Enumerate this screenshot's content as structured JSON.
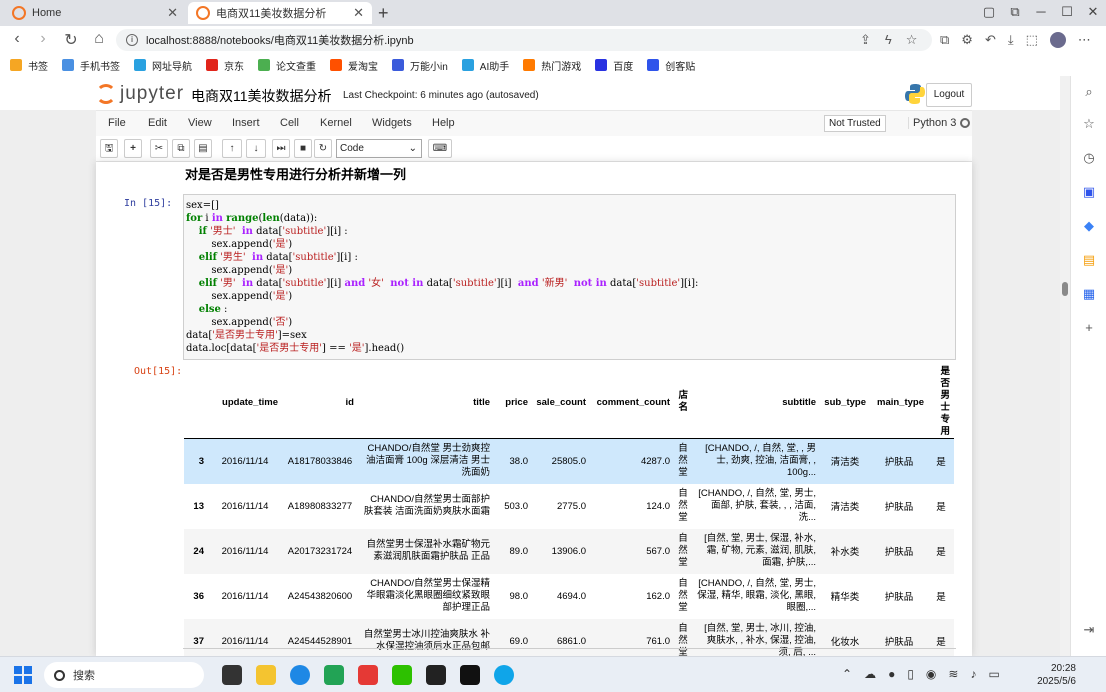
{
  "browser": {
    "tabs": [
      {
        "label": "Home"
      },
      {
        "label": "电商双11美妆数据分析"
      }
    ],
    "url": "localhost:8888/notebooks/电商双11美妆数据分析.ipynb",
    "bookmarks": [
      {
        "label": "书签",
        "color": "#f5a623"
      },
      {
        "label": "手机书签",
        "color": "#4a90e2"
      },
      {
        "label": "网址导航",
        "color": "#2aa1e0"
      },
      {
        "label": "京东",
        "color": "#e1251b"
      },
      {
        "label": "论文查重",
        "color": "#4caf50"
      },
      {
        "label": "爱淘宝",
        "color": "#ff5000"
      },
      {
        "label": "万能小in",
        "color": "#3b5bdb"
      },
      {
        "label": "AI助手",
        "color": "#2aa1e0"
      },
      {
        "label": "热门游戏",
        "color": "#ff7a00"
      },
      {
        "label": "百度",
        "color": "#2932e1"
      },
      {
        "label": "创客贴",
        "color": "#2f54eb"
      }
    ]
  },
  "jupyter": {
    "logo_text": "jupyter",
    "notebook_title": "电商双11美妆数据分析",
    "checkpoint": "Last Checkpoint: 6 minutes ago (autosaved)",
    "logout": "Logout",
    "menu": [
      "File",
      "Edit",
      "View",
      "Insert",
      "Cell",
      "Kernel",
      "Widgets",
      "Help"
    ],
    "trust": "Not Trusted",
    "kernel": "Python 3",
    "cell_type": "Code"
  },
  "markdown_heading": "对是否是男性专用进行分析并新增一列",
  "cell": {
    "in_prompt": "In  [15]:",
    "out_prompt": "Out[15]:"
  },
  "table": {
    "columns": [
      "",
      "update_time",
      "id",
      "title",
      "price",
      "sale_count",
      "comment_count",
      "店名",
      "subtitle",
      "sub_type",
      "main_type",
      "是否男士专用"
    ],
    "rows": [
      {
        "idx": "3",
        "update_time": "2016/11/14",
        "id": "A18178033846",
        "title": "CHANDO/自然堂 男士劲爽控油洁面膏 100g 深层清洁 男士洗面奶",
        "price": "38.0",
        "sale_count": "25805.0",
        "comment_count": "4287.0",
        "shop": "自然堂",
        "subtitle": "[CHANDO, /, 自然, 堂, , 男士, 劲爽, 控油, 洁面膏, , 100g...",
        "sub_type": "清洁类",
        "main_type": "护肤品",
        "male": "是"
      },
      {
        "idx": "13",
        "update_time": "2016/11/14",
        "id": "A18980833277",
        "title": "CHANDO/自然堂男士面部护肤套装 洁面洗面奶爽肤水面霜",
        "price": "503.0",
        "sale_count": "2775.0",
        "comment_count": "124.0",
        "shop": "自然堂",
        "subtitle": "[CHANDO, /, 自然, 堂, 男士, 面部, 护肤, 套装, , , 洁面, 洗...",
        "sub_type": "清洁类",
        "main_type": "护肤品",
        "male": "是"
      },
      {
        "idx": "24",
        "update_time": "2016/11/14",
        "id": "A20173231724",
        "title": "自然堂男士保湿补水霜矿物元素滋润肌肤面霜护肤品 正品",
        "price": "89.0",
        "sale_count": "13906.0",
        "comment_count": "567.0",
        "shop": "自然堂",
        "subtitle": "[自然, 堂, 男士, 保湿, 补水, 霜, 矿物, 元素, 滋润, 肌肤, 面霜, 护肤,...",
        "sub_type": "补水类",
        "main_type": "护肤品",
        "male": "是"
      },
      {
        "idx": "36",
        "update_time": "2016/11/14",
        "id": "A24543820600",
        "title": "CHANDO/自然堂男士保湿精华眼霜淡化黑眼圈细纹紧致眼部护理正品",
        "price": "98.0",
        "sale_count": "4694.0",
        "comment_count": "162.0",
        "shop": "自然堂",
        "subtitle": "[CHANDO, /, 自然, 堂, 男士, 保湿, 精华, 眼霜, 淡化, 黑眼, 眼圈,...",
        "sub_type": "精华类",
        "main_type": "护肤品",
        "male": "是"
      },
      {
        "idx": "37",
        "update_time": "2016/11/14",
        "id": "A24544528901",
        "title": "自然堂男士冰川控油爽肤水 补水保湿控油须后水正品包邮",
        "price": "69.0",
        "sale_count": "6861.0",
        "comment_count": "761.0",
        "shop": "自然堂",
        "subtitle": "[自然, 堂, 男士, 冰川, 控油, 爽肤水, , 补水, 保湿, 控油, 须, 后, ...",
        "sub_type": "化妆水",
        "main_type": "护肤品",
        "male": "是"
      }
    ]
  },
  "taskbar": {
    "search_placeholder": "搜索",
    "time": "20:28",
    "date": "2025/5/6"
  }
}
